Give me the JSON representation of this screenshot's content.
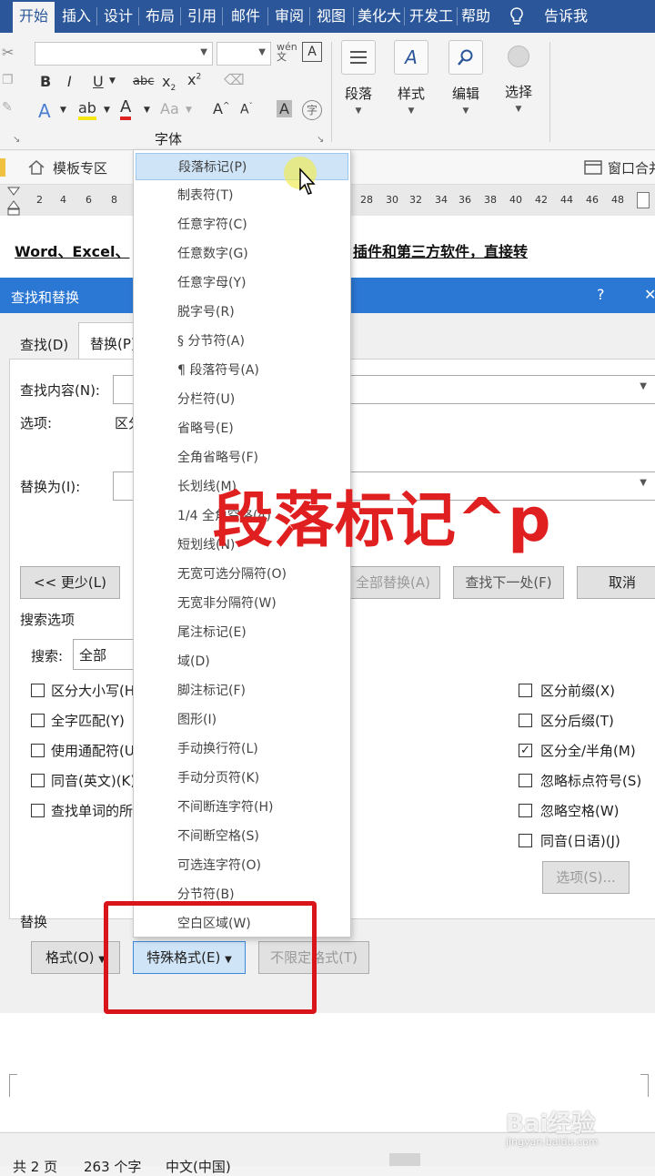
{
  "ribbon": {
    "tabs": [
      "开始",
      "插入",
      "设计",
      "布局",
      "引用",
      "邮件",
      "审阅",
      "视图",
      "美化大",
      "开发工",
      "帮助"
    ],
    "tell_me": "告诉我",
    "font_group_label": "字体",
    "big_buttons": [
      "段落",
      "样式",
      "编辑",
      "选择"
    ]
  },
  "template_bar": {
    "left": "模板专区",
    "right": "窗口合并"
  },
  "ruler": {
    "numbers_left": [
      "2",
      "4",
      "6",
      "8"
    ],
    "numbers_right": [
      "28",
      "30",
      "32",
      "34",
      "36",
      "38",
      "40",
      "42",
      "44",
      "46",
      "48"
    ]
  },
  "document": {
    "line_left": "Word、Excel、",
    "line_right": "插件和第三方软件，直接转"
  },
  "dialog": {
    "title": "查找和替换",
    "help": "?",
    "tabs": [
      "查找(D)",
      "替换(P)"
    ],
    "find_label": "查找内容(N):",
    "options_label": "选项:",
    "options_value": "区分",
    "replace_label": "替换为(I):",
    "less_button": "<< 更少(L)",
    "replace_all_button": "全部替换(A)",
    "find_next_button": "查找下一处(F)",
    "cancel_button": "取消",
    "search_options_label": "搜索选项",
    "search_label": "搜索:",
    "search_value": "全部",
    "left_checks": [
      {
        "label": "区分大小写(H)",
        "checked": false
      },
      {
        "label": "全字匹配(Y)",
        "checked": false
      },
      {
        "label": "使用通配符(U)",
        "checked": false
      },
      {
        "label": "同音(英文)(K)",
        "checked": false
      },
      {
        "label": "查找单词的所有形式(英文)(W)",
        "checked": false
      }
    ],
    "right_checks": [
      {
        "label": "区分前缀(X)",
        "checked": false
      },
      {
        "label": "区分后缀(T)",
        "checked": false
      },
      {
        "label": "区分全/半角(M)",
        "checked": true
      },
      {
        "label": "忽略标点符号(S)",
        "checked": false
      },
      {
        "label": "忽略空格(W)",
        "checked": false
      },
      {
        "label": "同音(日语)(J)",
        "checked": false
      }
    ],
    "options_button": "选项(S)...",
    "replace_section_label": "替换",
    "format_button": "格式(O)",
    "special_button": "特殊格式(E)",
    "no_format_button": "不限定格式(T)"
  },
  "menu": {
    "items": [
      "段落标记(P)",
      "制表符(T)",
      "任意字符(C)",
      "任意数字(G)",
      "任意字母(Y)",
      "脱字号(R)",
      "§ 分节符(A)",
      "¶ 段落符号(A)",
      "分栏符(U)",
      "省略号(E)",
      "全角省略号(F)",
      "长划线(M)",
      "1/4 全角空格(4)",
      "短划线(N)",
      "无宽可选分隔符(O)",
      "无宽非分隔符(W)",
      "尾注标记(E)",
      "域(D)",
      "脚注标记(F)",
      "图形(I)",
      "手动换行符(L)",
      "手动分页符(K)",
      "不间断连字符(H)",
      "不间断空格(S)",
      "可选连字符(O)",
      "分节符(B)",
      "空白区域(W)"
    ],
    "highlighted_index": 0
  },
  "overlay": {
    "big_text": "段落标记^p",
    "accent_color": "#e02020"
  },
  "statusbar": {
    "pages": "共 2 页",
    "words": "263 个字",
    "language": "中文(中国)"
  },
  "watermark": {
    "brand": "Bai经验",
    "url": "jingyan.baidu.com"
  }
}
